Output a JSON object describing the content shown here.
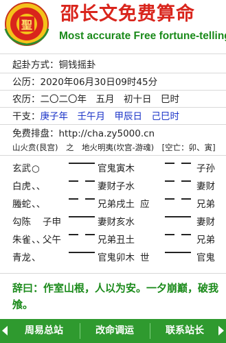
{
  "header": {
    "title_cn": "邵长文免费算命",
    "title_en": "Most accurate Free fortune-telling",
    "logo_text": "聖"
  },
  "info": {
    "method_label": "起卦方式：",
    "method_value": "铜钱摇卦",
    "gongli_label": "公历：",
    "gongli_value": "2020年06月30日09时45分",
    "nongli_label": "农历：",
    "nongli_value": "二〇二〇年　五月　初十日　巳时",
    "ganzhi_label": "干支：",
    "ganzhi_value": "庚子年　壬午月　甲辰日　己巳时",
    "paipan_label": "免费排盘：",
    "paipan_value": "http://cha.zy5000.cn",
    "gua_title": "山火贲(艮宫)　之　地火明夷(坎宫-游魂)　[空亡：卯、寅]"
  },
  "gua_rows": [
    {
      "shen": "玄武",
      "mark": "○",
      "fu": "",
      "left": "yang",
      "main": "官鬼寅木",
      "shi": "",
      "right": "yin",
      "bian": "子孙"
    },
    {
      "shen": "白虎",
      "mark": "、、",
      "fu": "",
      "left": "yin",
      "main": "妻财子水",
      "shi": "",
      "right": "yin",
      "bian": "妻财"
    },
    {
      "shen": "螣蛇",
      "mark": "、、",
      "fu": "",
      "left": "yin",
      "main": "兄弟戌土",
      "shi": "应",
      "right": "yin",
      "bian": "兄弟"
    },
    {
      "shen": "勾陈",
      "mark": "",
      "fu": "子申",
      "left": "yang",
      "main": "妻财亥水",
      "shi": "",
      "right": "yang",
      "bian": "妻财"
    },
    {
      "shen": "朱雀",
      "mark": "、、",
      "fu": "父午",
      "left": "yin",
      "main": "兄弟丑土",
      "shi": "",
      "right": "yin",
      "bian": "兄弟"
    },
    {
      "shen": "青龙",
      "mark": "、",
      "fu": "",
      "left": "yang",
      "main": "官鬼卯木",
      "shi": "世",
      "right": "yang",
      "bian": "官鬼"
    }
  ],
  "ci": "辞曰：作室山根，人以为安。一夕崩巅，破我 飧。",
  "footer": {
    "btn1": "周易总站",
    "btn2": "改命调运",
    "btn3": "联系站长"
  },
  "colors": {
    "red": "#d9251c",
    "green": "#1a8a1a",
    "blue": "#1a33c8",
    "footer_bg": "#2f9a2f"
  }
}
